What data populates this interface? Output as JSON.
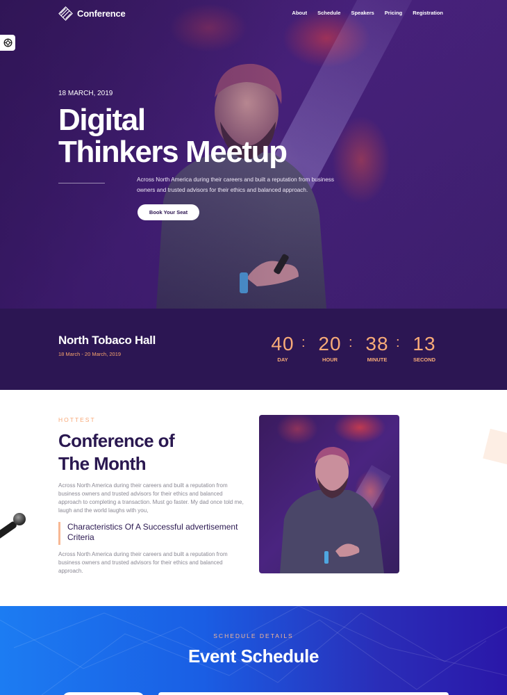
{
  "nav": {
    "logo_text": "Conference",
    "links": [
      "About",
      "Schedule",
      "Speakers",
      "Pricing",
      "Registration"
    ]
  },
  "hero": {
    "date": "18 MARCH, 2019",
    "title_line1": "Digital",
    "title_line2": "Thinkers Meetup",
    "description": "Across North America during their careers and built a reputation from business owners and trusted advisors for their ethics and balanced approach.",
    "button_label": "Book Your Seat"
  },
  "venue": {
    "name": "North Tobaco Hall",
    "dates": "18 March - 20 March, 2019"
  },
  "countdown": {
    "day": "40",
    "hour": "20",
    "minute": "38",
    "second": "13",
    "labels": {
      "day": "DAY",
      "hour": "HOUR",
      "minute": "MINUTE",
      "second": "SECOND"
    },
    "separator": ":"
  },
  "conference": {
    "kicker": "HOTTEST",
    "title_line1": "Conference of",
    "title_line2": "The Month",
    "body": "Across North America during their careers and built a reputation from business owners and trusted advisors for their ethics and balanced approach to completing a transaction. Must go faster. My dad once told me, laugh and the world laughs with you,",
    "quote": "Characteristics Of A Successful advertisement Criteria",
    "body2": "Across North America during their careers and built a reputation from business owners and trusted advisors for their ethics and balanced approach."
  },
  "schedule": {
    "kicker": "SCHEDULE DETAILS",
    "title": "Event Schedule"
  },
  "colors": {
    "hero_bg": "#3a1b5e",
    "band_bg": "#2c1653",
    "accent_peach": "#f8ab78",
    "heading_dark": "#2a1850",
    "schedule_blue": "#1c7cf2",
    "schedule_indigo": "#2a17a8"
  },
  "icons": {
    "logo": "diamond-stripes-icon",
    "side_widget": "lifebuoy-icon"
  }
}
